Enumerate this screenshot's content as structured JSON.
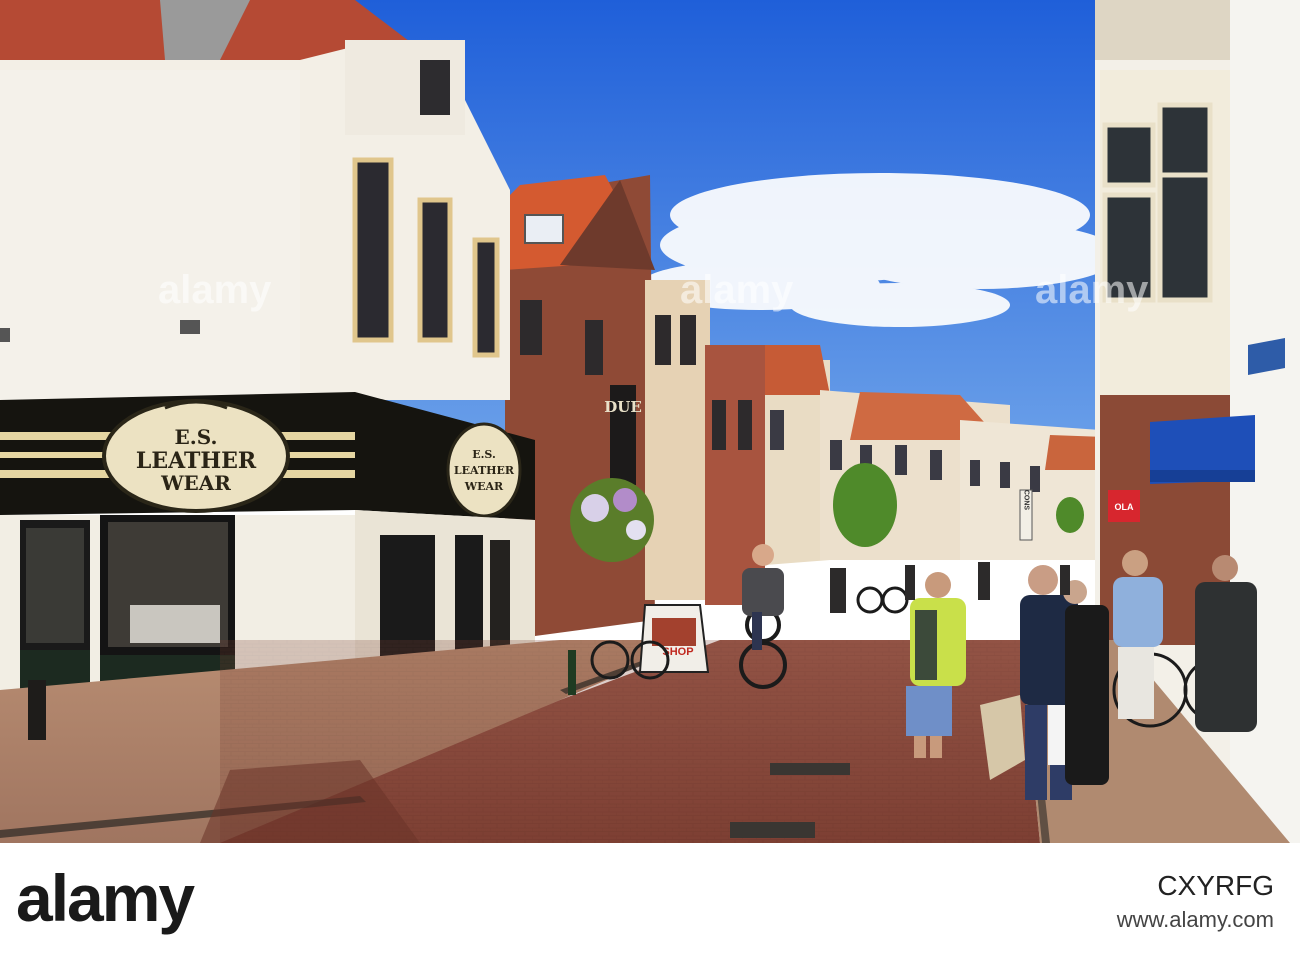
{
  "signs": {
    "shop_main_line1": "E.S.",
    "shop_main_line2": "LEATHER",
    "shop_main_line3": "WEAR",
    "shop_side_line1": "E.S.",
    "shop_side_line2": "LEATHER",
    "shop_side_line3": "WEAR",
    "hanging_sign": "DUE",
    "sandwich_board": "SHOP",
    "vertical_shop": "CONS",
    "ice_cream": "OLA"
  },
  "watermark": {
    "logo": "alamy",
    "image_id": "CXYRFG",
    "url": "www.alamy.com"
  },
  "colors": {
    "sky": "#2f6fe0",
    "brick": "#8e4a3e",
    "roof": "#c85a3a",
    "awning_blue": "#1e4fb8"
  }
}
